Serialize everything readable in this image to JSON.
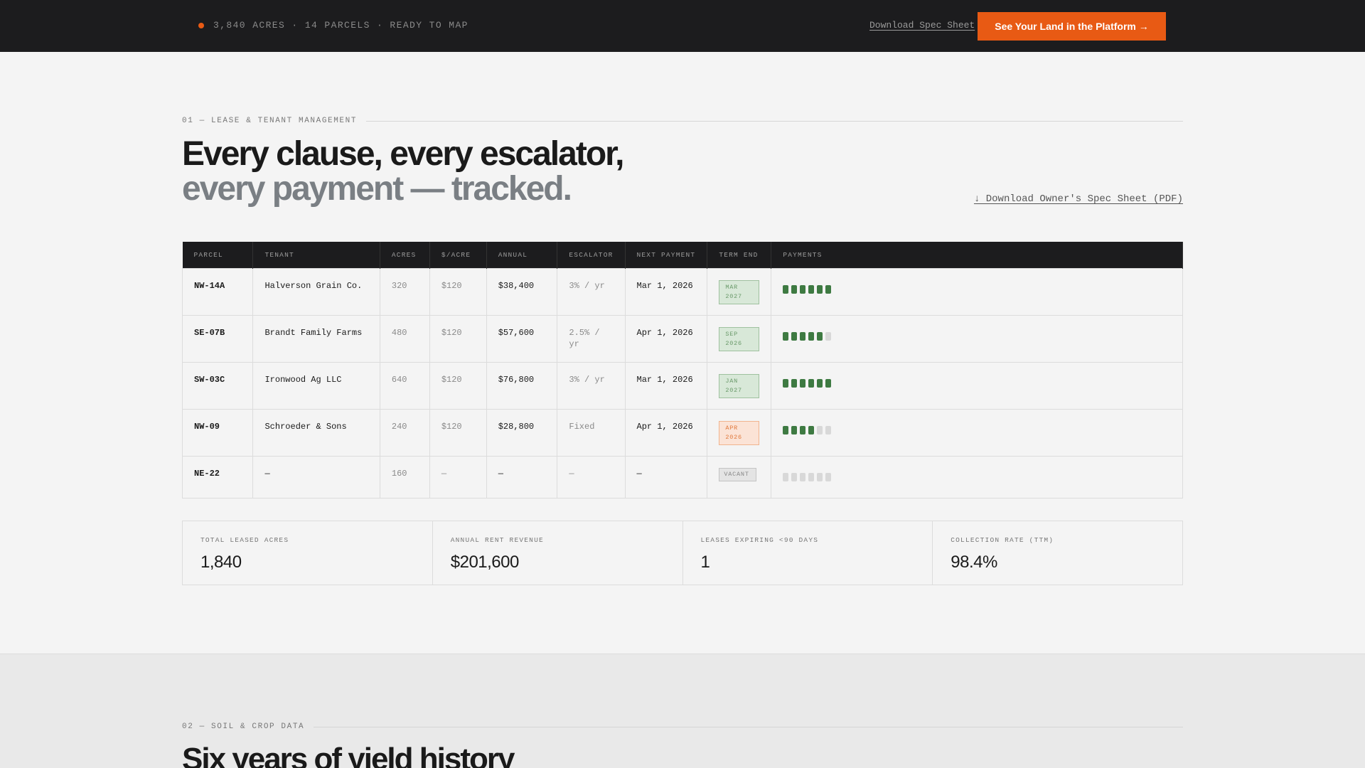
{
  "topbar": {
    "status_text": "3,840 ACRES · 14 PARCELS · READY TO MAP",
    "download_link": "Download Spec Sheet",
    "cta_label": "See Your Land in the Platform →",
    "accent": "#e85a14"
  },
  "section1": {
    "eyebrow": "01 — LEASE & TENANT MANAGEMENT",
    "headline_line1": "Every clause, every escalator,",
    "headline_line2": "every payment — tracked.",
    "pdf_link": "↓ Download Owner's Spec Sheet (PDF)"
  },
  "table": {
    "headers": [
      "PARCEL",
      "TENANT",
      "ACRES",
      "$/ACRE",
      "ANNUAL",
      "ESCALATOR",
      "NEXT PAYMENT",
      "TERM END",
      "PAYMENTS"
    ],
    "rows": [
      {
        "parcel": "NW-14A",
        "tenant": "Halverson Grain Co.",
        "acres": "320",
        "per_acre": "$120",
        "annual": "$38,400",
        "escalator": "3% / yr",
        "next_payment": "Mar 1, 2026",
        "term_end": "MAR 2027",
        "term_status": "green",
        "payments": [
          1,
          1,
          1,
          1,
          1,
          1
        ]
      },
      {
        "parcel": "SE-07B",
        "tenant": "Brandt Family Farms",
        "acres": "480",
        "per_acre": "$120",
        "annual": "$57,600",
        "escalator": "2.5% / yr",
        "next_payment": "Apr 1, 2026",
        "term_end": "SEP 2026",
        "term_status": "green",
        "payments": [
          1,
          1,
          1,
          1,
          1,
          0
        ]
      },
      {
        "parcel": "SW-03C",
        "tenant": "Ironwood Ag LLC",
        "acres": "640",
        "per_acre": "$120",
        "annual": "$76,800",
        "escalator": "3% / yr",
        "next_payment": "Mar 1, 2026",
        "term_end": "JAN 2027",
        "term_status": "green",
        "payments": [
          1,
          1,
          1,
          1,
          1,
          1
        ]
      },
      {
        "parcel": "NW-09",
        "tenant": "Schroeder & Sons",
        "acres": "240",
        "per_acre": "$120",
        "annual": "$28,800",
        "escalator": "Fixed",
        "next_payment": "Apr 1, 2026",
        "term_end": "APR 2026",
        "term_status": "orange",
        "payments": [
          1,
          1,
          1,
          1,
          0,
          0
        ]
      },
      {
        "parcel": "NE-22",
        "tenant": "—",
        "acres": "160",
        "per_acre": "—",
        "annual": "—",
        "escalator": "—",
        "next_payment": "—",
        "term_end": "VACANT",
        "term_status": "vacant",
        "payments": [
          0,
          0,
          0,
          0,
          0,
          0
        ]
      }
    ],
    "colors": {
      "paid": "#3e7a42",
      "unpaid": "#d8d8d8"
    }
  },
  "stats": [
    {
      "label": "TOTAL LEASED ACRES",
      "value": "1,840"
    },
    {
      "label": "ANNUAL RENT REVENUE",
      "value": "$201,600"
    },
    {
      "label": "LEASES EXPIRING <90 DAYS",
      "value": "1"
    },
    {
      "label": "COLLECTION RATE (TTM)",
      "value": "98.4%"
    }
  ],
  "section2": {
    "eyebrow": "02 — SOIL & CROP DATA",
    "headline": "Six years of yield history"
  }
}
